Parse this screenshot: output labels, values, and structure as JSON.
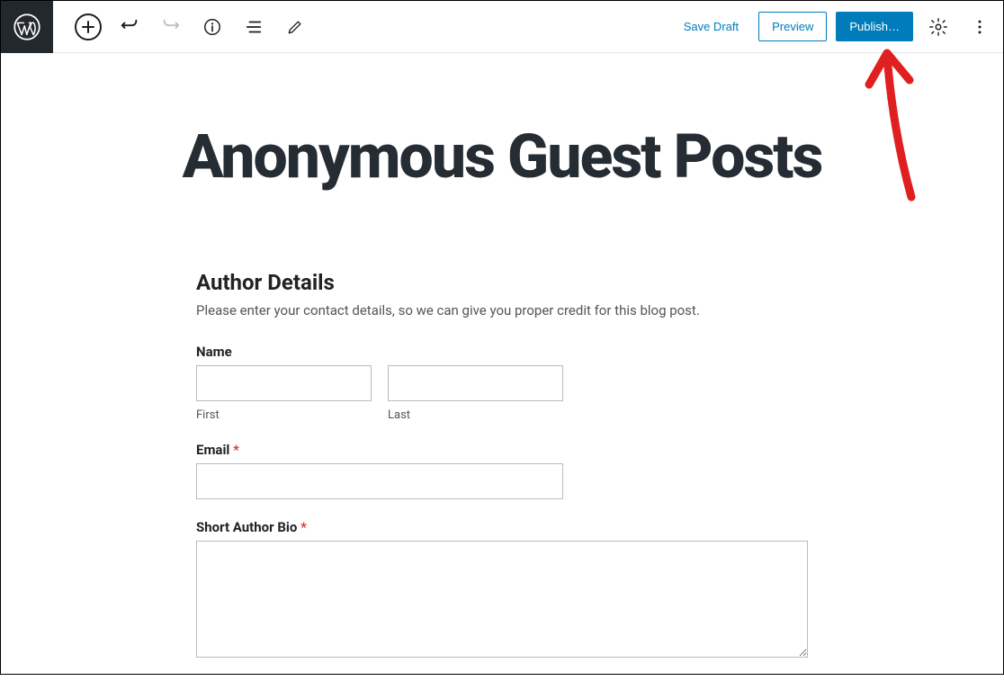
{
  "toolbar": {
    "save_draft_label": "Save Draft",
    "preview_label": "Preview",
    "publish_label": "Publish…"
  },
  "post": {
    "title": "Anonymous Guest Posts"
  },
  "form": {
    "section_heading": "Author Details",
    "section_description": "Please enter your contact details, so we can give you proper credit for this blog post.",
    "name": {
      "label": "Name",
      "first_sublabel": "First",
      "last_sublabel": "Last",
      "first_value": "",
      "last_value": ""
    },
    "email": {
      "label": "Email",
      "required_marker": "*",
      "value": ""
    },
    "bio": {
      "label": "Short Author Bio",
      "required_marker": "*",
      "value": ""
    }
  }
}
